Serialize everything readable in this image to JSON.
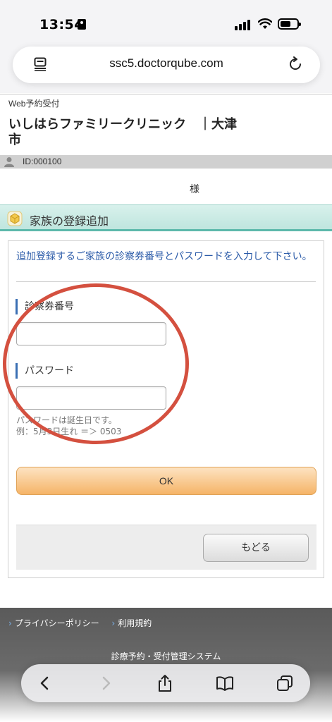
{
  "status_bar": {
    "time": "13:54"
  },
  "browser": {
    "url": "ssc5.doctorqube.com"
  },
  "header": {
    "site_label": "Web予約受付",
    "clinic_name": "いしはらファミリークリニック　｜大津市",
    "id_text": "ID:000100",
    "user_suffix": "様"
  },
  "section": {
    "title": "家族の登録追加"
  },
  "form": {
    "intro": "追加登録するご家族の診察券番号とパスワードを入力して下さい。",
    "card_number_label": "診察券番号",
    "card_number_value": "",
    "password_label": "パスワード",
    "password_value": "",
    "hint_line1": "パスワードは誕生日です。",
    "hint_line2": "例：5月3日生れ ＝＞ 0503",
    "ok_label": "OK",
    "back_label": "もどる"
  },
  "footer": {
    "links": [
      "プライバシーポリシー",
      "利用規約"
    ],
    "system_name": "診療予約・受付管理システム"
  },
  "colors": {
    "section_accent": "#5db9ab",
    "intro_text": "#2a5aa8",
    "ok_button": "#f5b467",
    "annotation_circle": "#d4503f"
  },
  "icons": [
    "person-status-icon",
    "signal-icon",
    "wifi-icon",
    "battery-icon",
    "reader-mode-icon",
    "reload-icon",
    "avatar-icon",
    "cube-icon",
    "back-arrow-icon",
    "forward-arrow-icon",
    "share-icon",
    "bookmarks-icon",
    "tabs-icon"
  ]
}
